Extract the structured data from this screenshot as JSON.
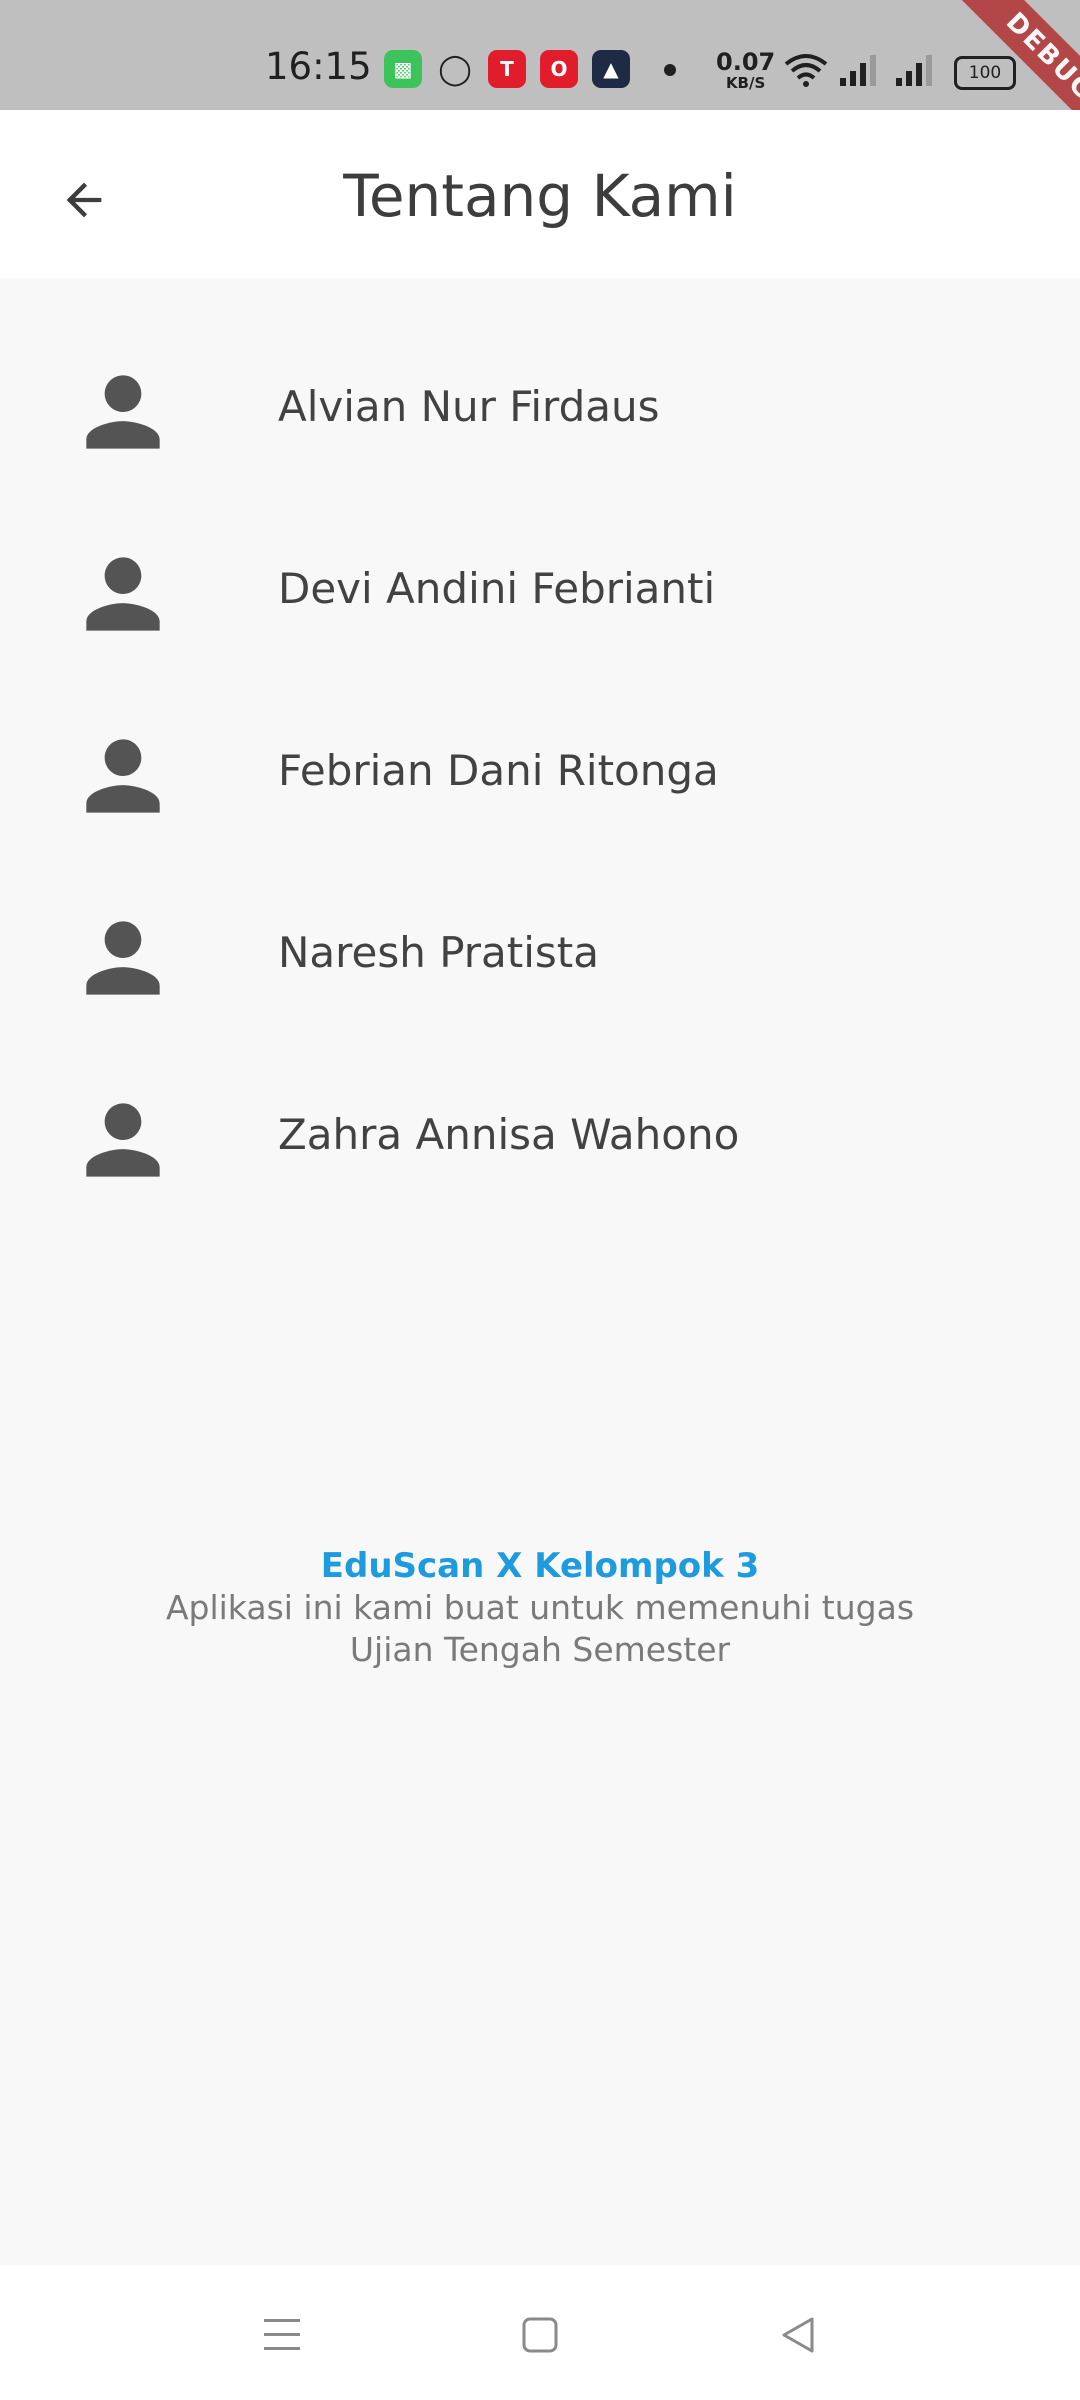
{
  "status_bar": {
    "time": "16:15",
    "net_speed_value": "0.07",
    "net_speed_unit": "KB/S",
    "battery": "100",
    "debug_banner": "DEBUG"
  },
  "app_bar": {
    "title": "Tentang Kami",
    "back_icon": "arrow-left-icon"
  },
  "members": [
    {
      "name": "Alvian Nur Firdaus",
      "icon": "person-icon"
    },
    {
      "name": "Devi Andini Febrianti",
      "icon": "person-icon"
    },
    {
      "name": "Febrian Dani Ritonga",
      "icon": "person-icon"
    },
    {
      "name": "Naresh Pratista",
      "icon": "person-icon"
    },
    {
      "name": "Zahra Annisa Wahono",
      "icon": "person-icon"
    }
  ],
  "footer": {
    "brand": "EduScan X Kelompok 3",
    "line1": "Aplikasi ini kami buat untuk memenuhi tugas",
    "line2": "Ujian Tengah Semester"
  },
  "colors": {
    "accent": "#1e9bde",
    "icon": "#545454",
    "background": "#f8f8f8"
  }
}
